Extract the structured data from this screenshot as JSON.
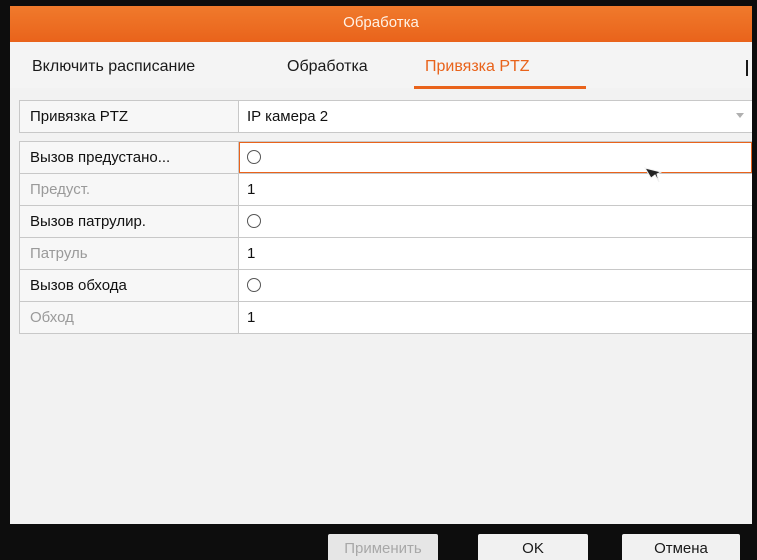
{
  "window": {
    "title": "Обработка"
  },
  "tabs": [
    {
      "label": "Включить расписание"
    },
    {
      "label": "Обработка"
    },
    {
      "label": "Привязка PTZ"
    }
  ],
  "form": {
    "ptz_link": {
      "label": "Привязка PTZ",
      "value": "IP камера 2"
    },
    "call_preset": {
      "label": "Вызов предустано...",
      "checked": false
    },
    "preset": {
      "label": "Предуст.",
      "value": "1"
    },
    "call_patrol": {
      "label": "Вызов патрулир.",
      "checked": false
    },
    "patrol": {
      "label": "Патруль",
      "value": "1"
    },
    "call_pattern": {
      "label": "Вызов обхода",
      "checked": false
    },
    "pattern": {
      "label": "Обход",
      "value": "1"
    }
  },
  "buttons": {
    "apply": "Применить",
    "ok": "OK",
    "cancel": "Отмена"
  },
  "colors": {
    "accent": "#e9631b",
    "background": "#f2f2f2",
    "frame": "#0d0d0d"
  }
}
